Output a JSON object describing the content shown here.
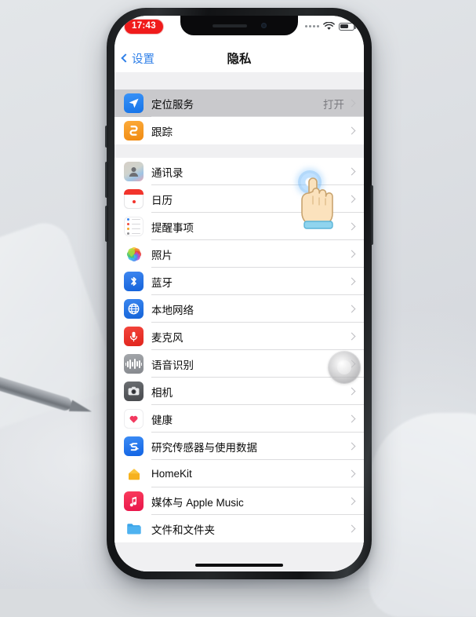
{
  "statusbar": {
    "recording_time": "17:43",
    "wifi_icon": "wifi-icon",
    "battery_icon": "battery-icon",
    "signal_icon": "signal-dots-icon"
  },
  "navbar": {
    "back_label": "设置",
    "title": "隐私"
  },
  "groups": [
    {
      "rows": [
        {
          "label": "定位服务",
          "value": "打开",
          "icon": "location-arrow-icon",
          "pressed": true
        },
        {
          "label": "跟踪",
          "value": "",
          "icon": "tracking-icon",
          "pressed": false
        }
      ]
    },
    {
      "rows": [
        {
          "label": "通讯录",
          "value": "",
          "icon": "contacts-icon",
          "pressed": false
        },
        {
          "label": "日历",
          "value": "",
          "icon": "calendar-icon",
          "pressed": false
        },
        {
          "label": "提醒事项",
          "value": "",
          "icon": "reminders-icon",
          "pressed": false
        },
        {
          "label": "照片",
          "value": "",
          "icon": "photos-icon",
          "pressed": false
        },
        {
          "label": "蓝牙",
          "value": "",
          "icon": "bluetooth-icon",
          "pressed": false
        },
        {
          "label": "本地网络",
          "value": "",
          "icon": "local-network-icon",
          "pressed": false
        },
        {
          "label": "麦克风",
          "value": "",
          "icon": "microphone-icon",
          "pressed": false
        },
        {
          "label": "语音识别",
          "value": "",
          "icon": "speech-recognition-icon",
          "pressed": false
        },
        {
          "label": "相机",
          "value": "",
          "icon": "camera-icon",
          "pressed": false
        },
        {
          "label": "健康",
          "value": "",
          "icon": "health-icon",
          "pressed": false
        },
        {
          "label": "研究传感器与使用数据",
          "value": "",
          "icon": "research-sensor-icon",
          "pressed": false
        },
        {
          "label": "HomeKit",
          "value": "",
          "icon": "homekit-icon",
          "pressed": false
        },
        {
          "label": "媒体与 Apple Music",
          "value": "",
          "icon": "apple-music-icon",
          "pressed": false
        },
        {
          "label": "文件和文件夹",
          "value": "",
          "icon": "files-folders-icon",
          "pressed": false
        }
      ]
    }
  ],
  "overlays": {
    "tap_indicator": "tap-ripple-indicator",
    "hand_cursor": "pointing-hand-cursor",
    "assistive_touch": "assistive-touch-button",
    "home_indicator": "home-indicator"
  },
  "colors": {
    "accent_blue": "#3080e8",
    "recording_red": "#f01b1b",
    "row_pressed": "#c9c9cc",
    "list_background": "#f0f0f2",
    "separator": "#dcdcde",
    "value_gray": "#8c8c90"
  }
}
